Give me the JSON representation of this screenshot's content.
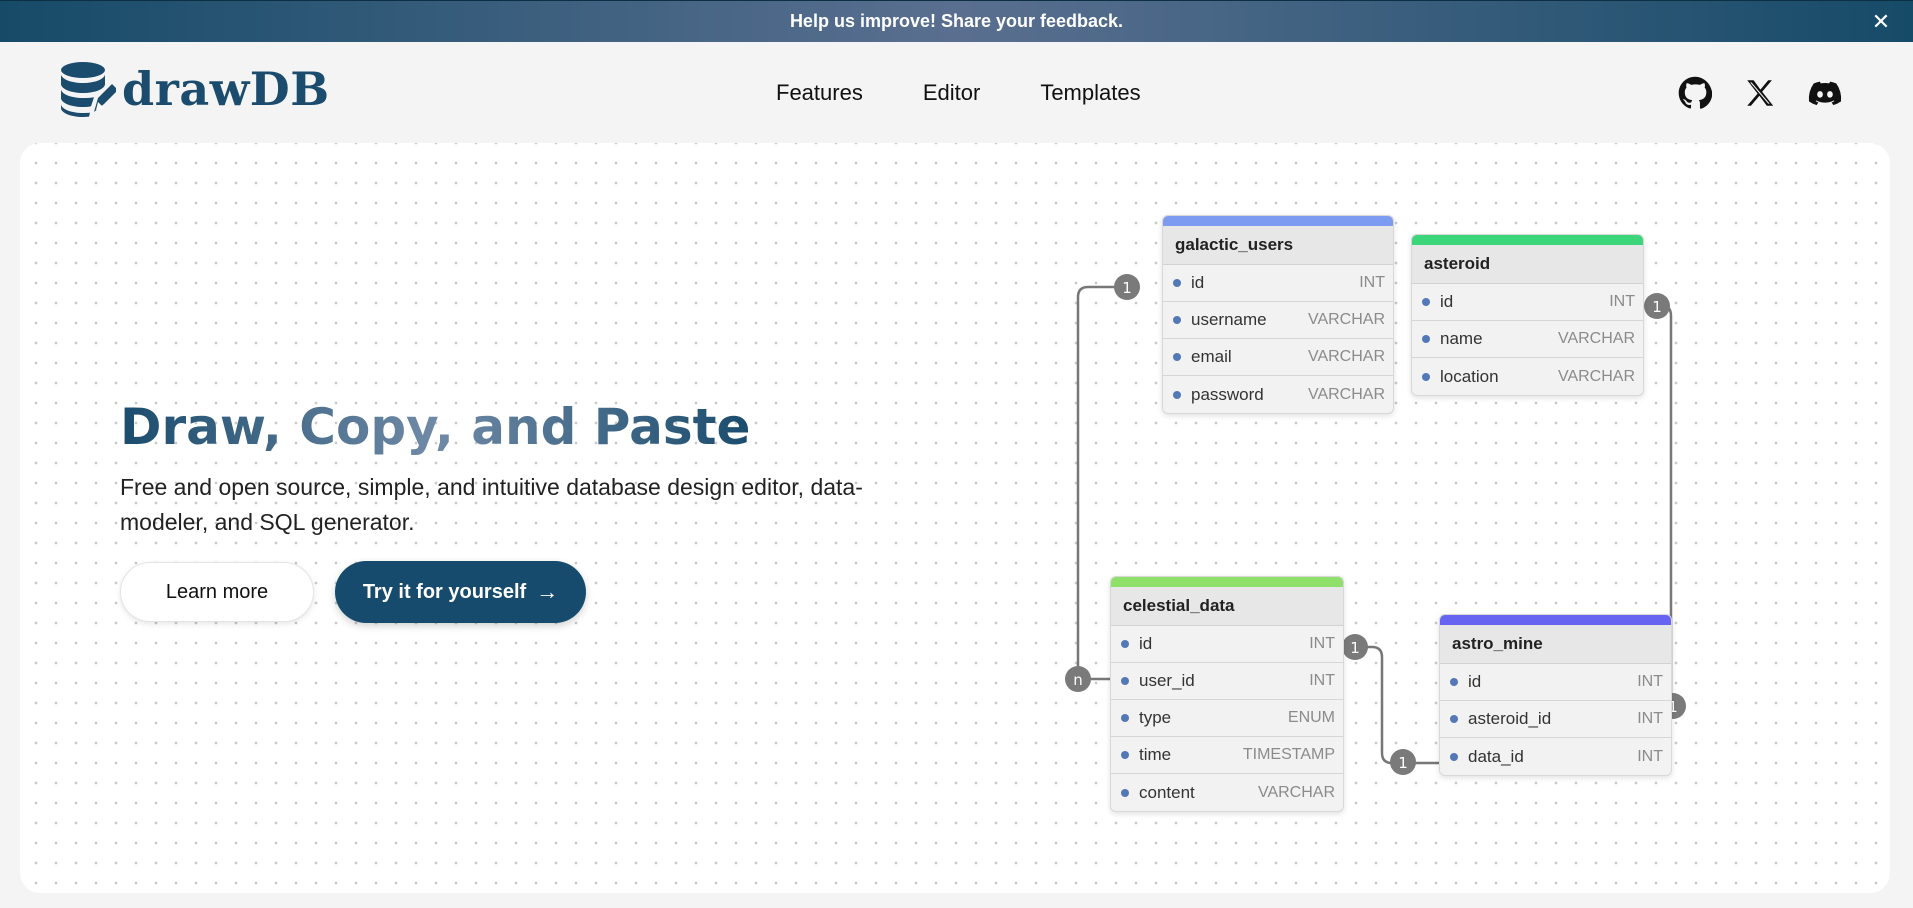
{
  "banner": {
    "text": "Help us improve! Share your feedback.",
    "close": "✕"
  },
  "header": {
    "logo_text": "drawDB",
    "nav": [
      "Features",
      "Editor",
      "Templates"
    ],
    "social_icons": [
      "github-icon",
      "x-icon",
      "discord-icon"
    ]
  },
  "hero": {
    "title": "Draw, Copy, and Paste",
    "subtitle": "Free and open source, simple, and intuitive database design editor, data-modeler, and SQL generator.",
    "learn_more": "Learn more",
    "try": "Try it for yourself",
    "try_arrow": "→"
  },
  "colors": {
    "accent": "#174b6d",
    "galactic_users": "#7e9bf2",
    "asteroid": "#3dd57a",
    "celestial_data": "#8ee06a",
    "astro_mine": "#6664f0"
  },
  "tables": {
    "galactic_users": {
      "name": "galactic_users",
      "fields": [
        {
          "name": "id",
          "type": "INT"
        },
        {
          "name": "username",
          "type": "VARCHAR"
        },
        {
          "name": "email",
          "type": "VARCHAR"
        },
        {
          "name": "password",
          "type": "VARCHAR"
        }
      ]
    },
    "asteroid": {
      "name": "asteroid",
      "fields": [
        {
          "name": "id",
          "type": "INT"
        },
        {
          "name": "name",
          "type": "VARCHAR"
        },
        {
          "name": "location",
          "type": "VARCHAR"
        }
      ]
    },
    "celestial_data": {
      "name": "celestial_data",
      "fields": [
        {
          "name": "id",
          "type": "INT"
        },
        {
          "name": "user_id",
          "type": "INT"
        },
        {
          "name": "type",
          "type": "ENUM"
        },
        {
          "name": "time",
          "type": "TIMESTAMP"
        },
        {
          "name": "content",
          "type": "VARCHAR"
        }
      ]
    },
    "astro_mine": {
      "name": "astro_mine",
      "fields": [
        {
          "name": "id",
          "type": "INT"
        },
        {
          "name": "asteroid_id",
          "type": "INT"
        },
        {
          "name": "data_id",
          "type": "INT"
        }
      ]
    }
  },
  "relations": {
    "users_to_data": {
      "from": "1",
      "to": "n"
    },
    "data_to_mine": {
      "from": "1",
      "to": "1"
    },
    "asteroid_to_mine": {
      "from": "1",
      "to": "1"
    }
  }
}
